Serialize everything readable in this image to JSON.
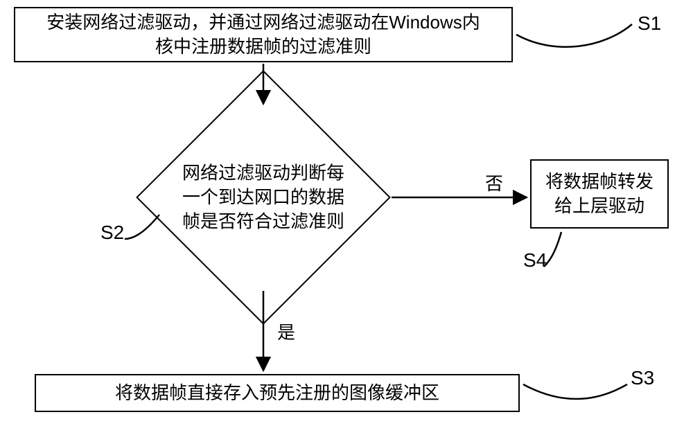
{
  "nodes": {
    "s1": {
      "text": "安装网络过滤驱动，并通过网络过滤驱动在Windows内\n核中注册数据帧的过滤准则",
      "label": "S1"
    },
    "s2": {
      "text": "网络过滤驱动判断每\n一个到达网口的数据\n帧是否符合过滤准则",
      "label": "S2"
    },
    "s3": {
      "text": "将数据帧直接存入预先注册的图像缓冲区",
      "label": "S3"
    },
    "s4": {
      "text": "将数据帧转发\n给上层驱动",
      "label": "S4"
    }
  },
  "edges": {
    "yes": "是",
    "no": "否"
  }
}
